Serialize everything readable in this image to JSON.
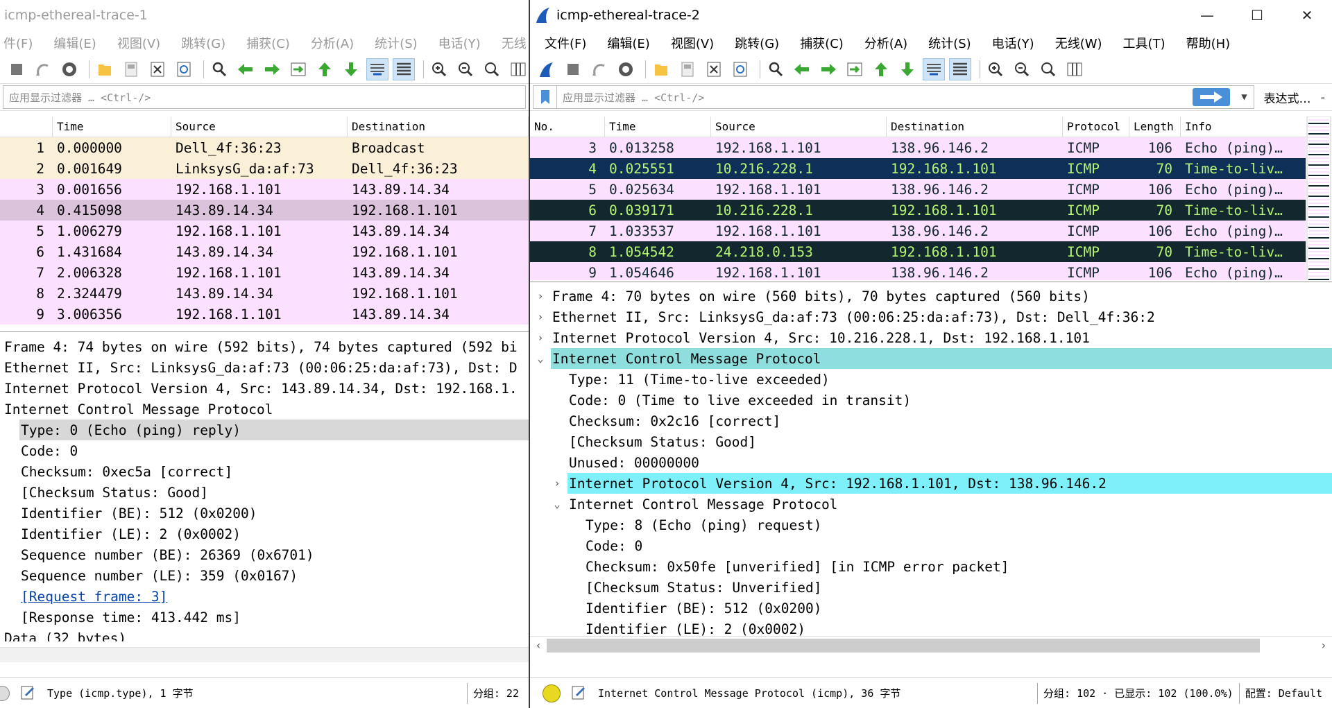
{
  "window1": {
    "title": "icmp-ethereal-trace-1",
    "menu": [
      "件(F)",
      "编辑(E)",
      "视图(V)",
      "跳转(G)",
      "捕获(C)",
      "分析(A)",
      "统计(S)",
      "电话(Y)",
      "无线"
    ],
    "filter_placeholder": "应用显示过滤器 … <Ctrl-/>",
    "columns": [
      "Time",
      "Source",
      "Destination"
    ],
    "packets": [
      {
        "no": "1",
        "time": "0.000000",
        "source": "Dell_4f:36:23",
        "destination": "Broadcast",
        "bg": "#faf0d7"
      },
      {
        "no": "2",
        "time": "0.001649",
        "source": "LinksysG_da:af:73",
        "destination": "Dell_4f:36:23",
        "bg": "#faf0d7"
      },
      {
        "no": "3",
        "time": "0.001656",
        "source": "192.168.1.101",
        "destination": "143.89.14.34",
        "bg": "#fce0ff"
      },
      {
        "no": "4",
        "time": "0.415098",
        "source": "143.89.14.34",
        "destination": "192.168.1.101",
        "bg": "#dcc3dc"
      },
      {
        "no": "5",
        "time": "1.006279",
        "source": "192.168.1.101",
        "destination": "143.89.14.34",
        "bg": "#fce0ff"
      },
      {
        "no": "6",
        "time": "1.431684",
        "source": "143.89.14.34",
        "destination": "192.168.1.101",
        "bg": "#fce0ff"
      },
      {
        "no": "7",
        "time": "2.006328",
        "source": "192.168.1.101",
        "destination": "143.89.14.34",
        "bg": "#fce0ff"
      },
      {
        "no": "8",
        "time": "2.324479",
        "source": "143.89.14.34",
        "destination": "192.168.1.101",
        "bg": "#fce0ff"
      },
      {
        "no": "9",
        "time": "3.006356",
        "source": "192.168.1.101",
        "destination": "143.89.14.34",
        "bg": "#fce0ff"
      }
    ],
    "details": [
      {
        "text": "Frame 4: 74 bytes on wire (592 bits), 74 bytes captured (592 bi",
        "indent": 0,
        "style": "plain"
      },
      {
        "text": "Ethernet II, Src: LinksysG_da:af:73 (00:06:25:da:af:73), Dst: D",
        "indent": 0,
        "style": "plain"
      },
      {
        "text": "Internet Protocol Version 4, Src: 143.89.14.34, Dst: 192.168.1.",
        "indent": 0,
        "style": "plain"
      },
      {
        "text": "Internet Control Message Protocol",
        "indent": 0,
        "style": "plain"
      },
      {
        "text": "Type: 0 (Echo (ping) reply)",
        "indent": 1,
        "style": "selected"
      },
      {
        "text": "Code: 0",
        "indent": 1,
        "style": "plain"
      },
      {
        "text": "Checksum: 0xec5a [correct]",
        "indent": 1,
        "style": "plain"
      },
      {
        "text": "[Checksum Status: Good]",
        "indent": 1,
        "style": "plain"
      },
      {
        "text": "Identifier (BE): 512 (0x0200)",
        "indent": 1,
        "style": "plain"
      },
      {
        "text": "Identifier (LE): 2 (0x0002)",
        "indent": 1,
        "style": "plain"
      },
      {
        "text": "Sequence number (BE): 26369 (0x6701)",
        "indent": 1,
        "style": "plain"
      },
      {
        "text": "Sequence number (LE): 359 (0x0167)",
        "indent": 1,
        "style": "plain"
      },
      {
        "text": "[Request frame: 3]",
        "indent": 1,
        "style": "link"
      },
      {
        "text": "[Response time: 413.442 ms]",
        "indent": 1,
        "style": "plain"
      },
      {
        "text": "Data (32 bytes)",
        "indent": 0,
        "style": "collapsed"
      }
    ],
    "status_text": "Type (icmp.type), 1 字节",
    "status_group": "分组: 22"
  },
  "window2": {
    "title": "icmp-ethereal-trace-2",
    "menu": [
      "文件(F)",
      "编辑(E)",
      "视图(V)",
      "跳转(G)",
      "捕获(C)",
      "分析(A)",
      "统计(S)",
      "电话(Y)",
      "无线(W)",
      "工具(T)",
      "帮助(H)"
    ],
    "filter_placeholder": "应用显示过滤器 … <Ctrl-/>",
    "expression_label": "表达式…",
    "columns": [
      "No.",
      "Time",
      "Source",
      "Destination",
      "Protocol",
      "Length",
      "Info"
    ],
    "packets": [
      {
        "no": "3",
        "time": "0.013258",
        "source": "192.168.1.101",
        "destination": "138.96.146.2",
        "protocol": "ICMP",
        "length": "106",
        "info": "Echo (ping)…",
        "bg": "#fce0ff",
        "fg": "#12272e"
      },
      {
        "no": "4",
        "time": "0.025551",
        "source": "10.216.228.1",
        "destination": "192.168.1.101",
        "protocol": "ICMP",
        "length": "70",
        "info": "Time-to-liv…",
        "bg": "#0e3058",
        "fg": "#b7f774"
      },
      {
        "no": "5",
        "time": "0.025634",
        "source": "192.168.1.101",
        "destination": "138.96.146.2",
        "protocol": "ICMP",
        "length": "106",
        "info": "Echo (ping)…",
        "bg": "#fce0ff",
        "fg": "#12272e"
      },
      {
        "no": "6",
        "time": "0.039171",
        "source": "10.216.228.1",
        "destination": "192.168.1.101",
        "protocol": "ICMP",
        "length": "70",
        "info": "Time-to-liv…",
        "bg": "#12272e",
        "fg": "#b7f774"
      },
      {
        "no": "7",
        "time": "1.033537",
        "source": "192.168.1.101",
        "destination": "138.96.146.2",
        "protocol": "ICMP",
        "length": "106",
        "info": "Echo (ping)…",
        "bg": "#fce0ff",
        "fg": "#12272e"
      },
      {
        "no": "8",
        "time": "1.054542",
        "source": "24.218.0.153",
        "destination": "192.168.1.101",
        "protocol": "ICMP",
        "length": "70",
        "info": "Time-to-liv…",
        "bg": "#12272e",
        "fg": "#b7f774"
      },
      {
        "no": "9",
        "time": "1.054646",
        "source": "192.168.1.101",
        "destination": "138.96.146.2",
        "protocol": "ICMP",
        "length": "106",
        "info": "Echo (ping)…",
        "bg": "#fce0ff",
        "fg": "#12272e"
      }
    ],
    "details": [
      {
        "text": "Frame 4: 70 bytes on wire (560 bits), 70 bytes captured (560 bits)",
        "indent": 0,
        "style": "collapsed"
      },
      {
        "text": "Ethernet II, Src: LinksysG_da:af:73 (00:06:25:da:af:73), Dst: Dell_4f:36:2",
        "indent": 0,
        "style": "collapsed"
      },
      {
        "text": "Internet Protocol Version 4, Src: 10.216.228.1, Dst: 192.168.1.101",
        "indent": 0,
        "style": "collapsed"
      },
      {
        "text": "Internet Control Message Protocol",
        "indent": 0,
        "style": "expanded-selected"
      },
      {
        "text": "Type: 11 (Time-to-live exceeded)",
        "indent": 1,
        "style": "plain"
      },
      {
        "text": "Code: 0 (Time to live exceeded in transit)",
        "indent": 1,
        "style": "plain"
      },
      {
        "text": "Checksum: 0x2c16 [correct]",
        "indent": 1,
        "style": "plain"
      },
      {
        "text": "[Checksum Status: Good]",
        "indent": 1,
        "style": "plain"
      },
      {
        "text": "Unused: 00000000",
        "indent": 1,
        "style": "plain"
      },
      {
        "text": "Internet Protocol Version 4, Src: 192.168.1.101, Dst: 138.96.146.2",
        "indent": 1,
        "style": "collapsed-highlight"
      },
      {
        "text": "Internet Control Message Protocol",
        "indent": 1,
        "style": "expanded"
      },
      {
        "text": "Type: 8 (Echo (ping) request)",
        "indent": 2,
        "style": "plain"
      },
      {
        "text": "Code: 0",
        "indent": 2,
        "style": "plain"
      },
      {
        "text": "Checksum: 0x50fe [unverified] [in ICMP error packet]",
        "indent": 2,
        "style": "plain"
      },
      {
        "text": "[Checksum Status: Unverified]",
        "indent": 2,
        "style": "plain"
      },
      {
        "text": "Identifier (BE): 512 (0x0200)",
        "indent": 2,
        "style": "plain"
      },
      {
        "text": "Identifier (LE): 2 (0x0002)",
        "indent": 2,
        "style": "plain"
      }
    ],
    "status_text": "Internet Control Message Protocol (icmp), 36 字节",
    "status_group": "分组: 102 · 已显示: 102 (100.0%)",
    "status_profile": "配置: Default"
  },
  "colors": {
    "selected_detail": "#d8d8d8",
    "icmp_highlight": "#8edede",
    "ip_highlight": "#7ef0fa",
    "link": "#0645ad",
    "logo": "#1e5bb8"
  }
}
